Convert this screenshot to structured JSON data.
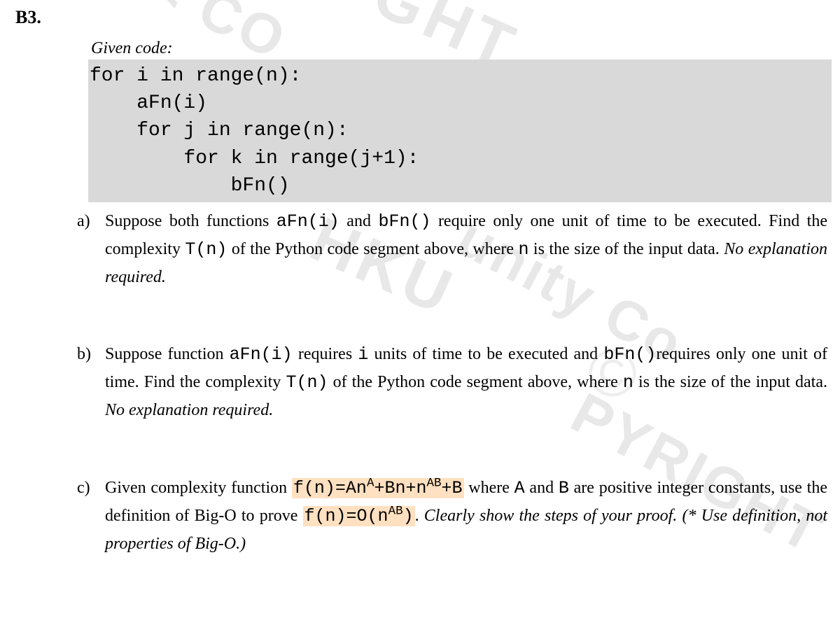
{
  "question_number": "B3.",
  "given_label": "Given code:",
  "code_lines": {
    "l1": "for i in range(n):",
    "l2": "    aFn(i)",
    "l3": "    for j in range(n):",
    "l4": "        for k in range(j+1):",
    "l5": "            bFn()"
  },
  "parts": {
    "a": {
      "label": "a)",
      "t1": "Suppose both functions ",
      "c1": "aFn(i)",
      "t2": " and ",
      "c2": "bFn()",
      "t3": " require only one unit of time to be executed. Find the complexity ",
      "c3": "T(n)",
      "t4": " of the Python code segment above, where ",
      "c4": "n",
      "t5": " is the size of the input data.   ",
      "i1": "No explanation required."
    },
    "b": {
      "label": "b)",
      "t1": "Suppose function ",
      "c1": "aFn(i)",
      "t2": " requires ",
      "c2": "i",
      "t3": " units of time to be executed and ",
      "c3": "bFn()",
      "t4": "requires only one unit of time.   Find the complexity ",
      "c4": "T(n)",
      "t5": " of the Python code segment above, where ",
      "c5": "n",
      "t6": " is the size of the input data.   ",
      "i1": "No explanation required."
    },
    "c": {
      "label": "c)",
      "t1": "Given complexity function  ",
      "h1a": "f(n)=An",
      "h1sup1": "A",
      "h1b": "+Bn+n",
      "h1sup2": "AB",
      "h1c": "+B",
      "t2": " where ",
      "c1": "A",
      "t3": " and ",
      "c2": "B",
      "t4": " are positive integer constants, use the definition of Big-O to prove  ",
      "h2a": "f(n)=O(n",
      "h2sup": "AB",
      "h2b": ")",
      "t5": ".   ",
      "i1": "Clearly show the steps of your proof.   (* Use definition, not properties of Big-O.)"
    }
  },
  "watermarks": {
    "w1": "GHT",
    "w2": "< CO",
    "w3": "HKU",
    "w4": "unity Co",
    "w5": "PYRIGHT",
    "w6": "©"
  }
}
